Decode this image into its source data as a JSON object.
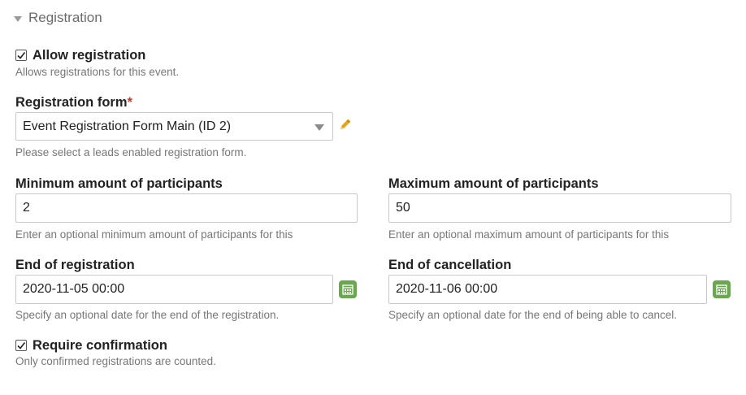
{
  "section": {
    "title": "Registration",
    "icon": "caret-down-icon"
  },
  "allow_registration": {
    "label": "Allow registration",
    "checked": true,
    "help": "Allows registrations for this event."
  },
  "registration_form": {
    "label": "Registration form",
    "required_mark": "*",
    "value": "Event Registration Form Main (ID 2)",
    "help": "Please select a leads enabled registration form.",
    "edit_icon": "pencil-icon"
  },
  "min_participants": {
    "label": "Minimum amount of participants",
    "value": "2",
    "help": "Enter an optional minimum amount of participants for this"
  },
  "max_participants": {
    "label": "Maximum amount of participants",
    "value": "50",
    "help": "Enter an optional maximum amount of participants for this"
  },
  "end_of_registration": {
    "label": "End of registration",
    "value": "2020-11-05 00:00",
    "help": "Specify an optional date for the end of the registration.",
    "icon": "calendar-icon"
  },
  "end_of_cancellation": {
    "label": "End of cancellation",
    "value": "2020-11-06 00:00",
    "help": "Specify an optional date for the end of being able to cancel.",
    "icon": "calendar-icon"
  },
  "require_confirmation": {
    "label": "Require confirmation",
    "checked": true,
    "help": "Only confirmed registrations are counted."
  },
  "colors": {
    "calendar_button": "#6aa84f",
    "pencil": "#e8a317",
    "required": "#c0392b"
  }
}
